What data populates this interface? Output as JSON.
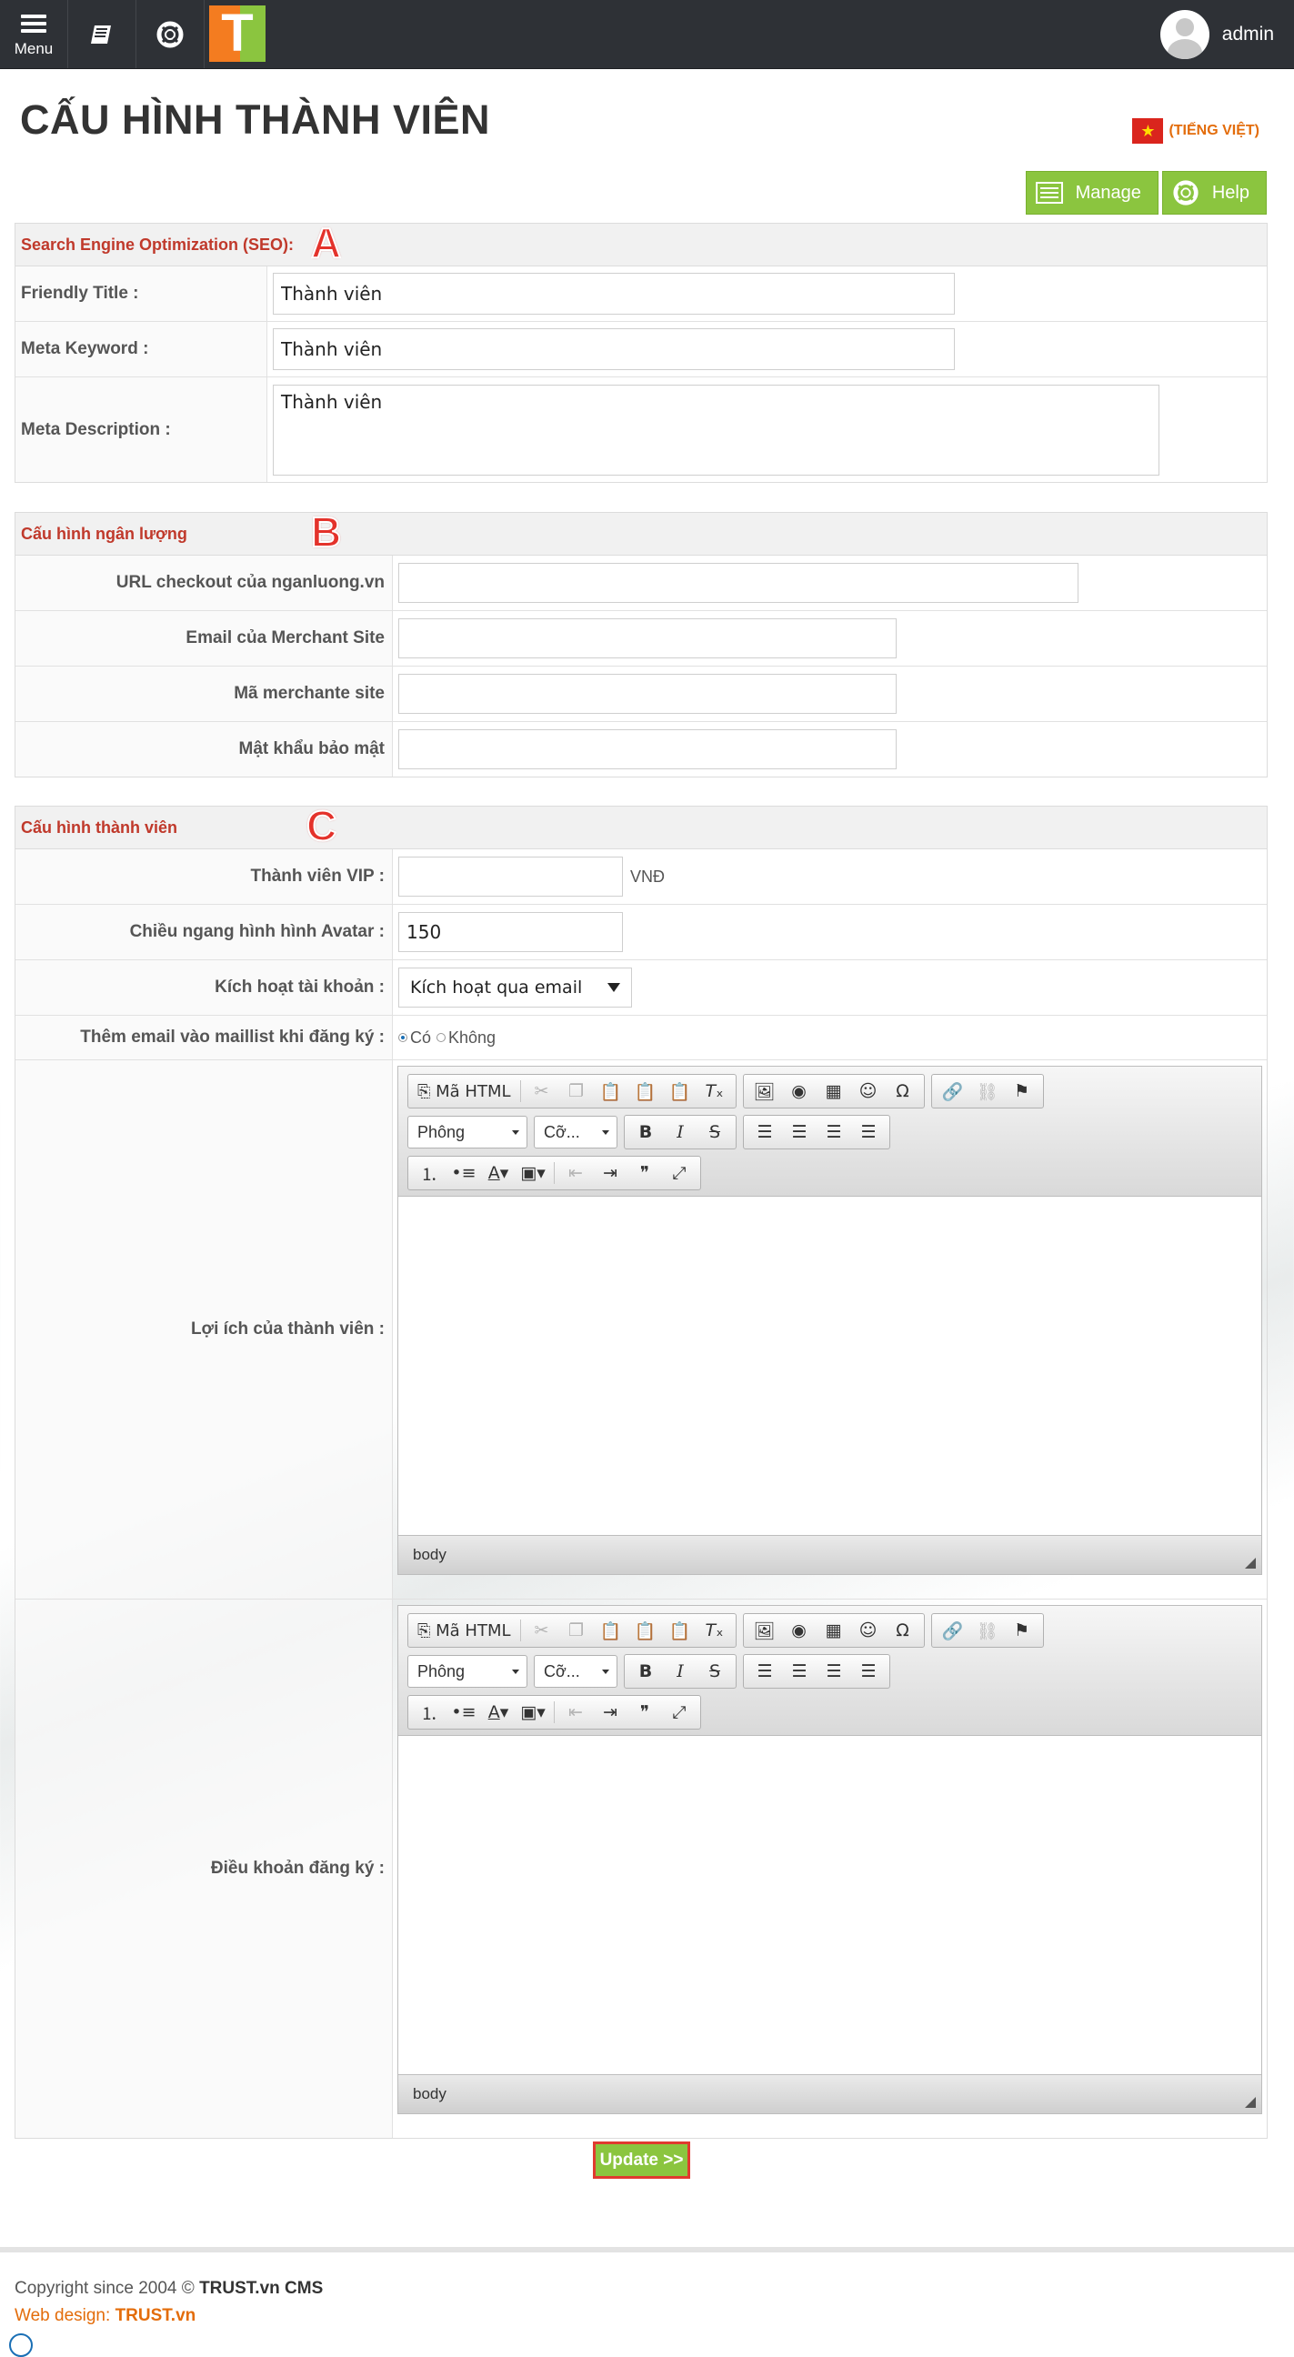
{
  "topbar": {
    "menu_label": "Menu",
    "logo_letter": "T",
    "user_name": "admin"
  },
  "page": {
    "title": "CẤU HÌNH THÀNH VIÊN",
    "language": "(TIẾNG VIỆT)",
    "actions": {
      "manage": "Manage",
      "help": "Help"
    }
  },
  "seo": {
    "title": "Search Engine Optimization (SEO):",
    "marker": "A",
    "friendly_title_label": "Friendly Title :",
    "friendly_title_value": "Thành viên",
    "meta_keyword_label": "Meta Keyword :",
    "meta_keyword_value": "Thành viên",
    "meta_description_label": "Meta Description :",
    "meta_description_value": "Thành viên"
  },
  "nganluong": {
    "title": "Cấu hình ngân lượng",
    "marker": "B",
    "url_label": "URL checkout của nganluong.vn",
    "url_value": "",
    "email_label": "Email của Merchant Site",
    "email_value": "",
    "merchant_label": "Mã merchante site",
    "merchant_value": "",
    "password_label": "Mật khẩu bảo mật",
    "password_value": ""
  },
  "member": {
    "title": "Cấu hình thành viên",
    "marker": "C",
    "vip_label": "Thành viên VIP :",
    "vip_value": "",
    "vip_unit": "VNĐ",
    "avatar_label": "Chiều ngang hình hình Avatar :",
    "avatar_value": "150",
    "activate_label": "Kích hoạt tài khoản :",
    "activate_value": "Kích hoạt qua email",
    "maillist_label": "Thêm email vào maillist khi đăng ký :",
    "maillist_yes": "Có",
    "maillist_no": "Không",
    "benefits_label": "Lợi ích của thành viên :",
    "terms_label": "Điều khoản đăng ký :"
  },
  "editor": {
    "source_label": "Mã HTML",
    "font_label": "Phông",
    "size_label": "Cỡ...",
    "footer_path": "body"
  },
  "update_label": "Update >>",
  "footer": {
    "copyright_prefix": "Copyright since 2004 ©",
    "copyright_brand": "TRUST.vn CMS",
    "webdesign_prefix": "Web design:",
    "webdesign_brand": "TRUST.vn"
  }
}
